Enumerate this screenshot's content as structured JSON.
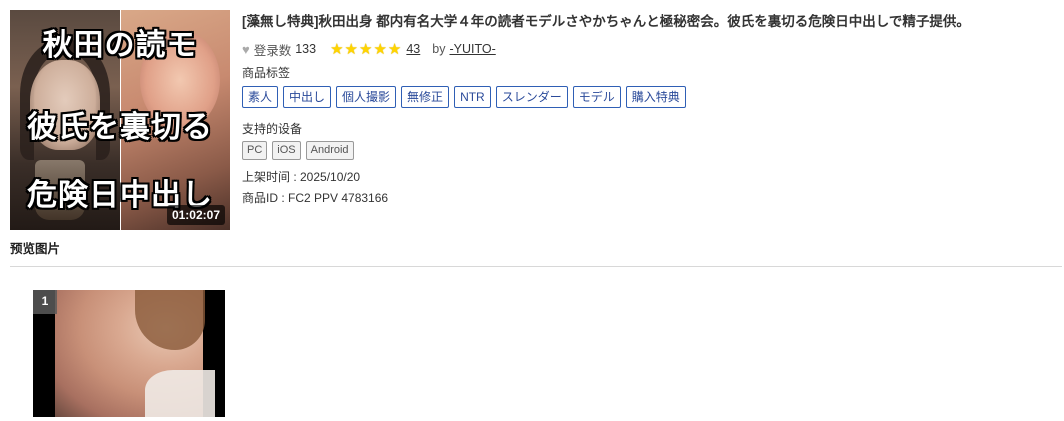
{
  "product": {
    "title": "[藻無し特典]秋田出身 都内有名大学４年の読者モデルさやかちゃんと極秘密会。彼氏を裏切る危険日中出しで精子提供。",
    "thumbnail": {
      "caption_lines": [
        "秋田の読モ",
        "彼氏を裏切る",
        "危険日中出し"
      ],
      "duration": "01:02:07"
    },
    "favorites": {
      "label": "登录数",
      "count": "133",
      "icon": "heart-icon"
    },
    "rating": {
      "stars": 5,
      "max": 5,
      "review_count": "43",
      "icon": "star-icon",
      "color": "#ffd400"
    },
    "seller": {
      "by_label": "by",
      "name": "-YUITO-"
    },
    "tags_label": "商品标签",
    "tags": [
      "素人",
      "中出し",
      "個人撮影",
      "無修正",
      "NTR",
      "スレンダー",
      "モデル",
      "購入特典"
    ],
    "devices_label": "支持的设备",
    "devices": [
      "PC",
      "iOS",
      "Android"
    ],
    "release_date": "上架时间 : 2025/10/20",
    "product_id": "商品ID : FC2 PPV 4783166"
  },
  "preview": {
    "heading": "预览图片",
    "items": [
      {
        "index": "1"
      }
    ]
  },
  "colors": {
    "tag_border": "#2f5fb5",
    "tag_text": "#2a4a9a",
    "star": "#ffd400"
  }
}
